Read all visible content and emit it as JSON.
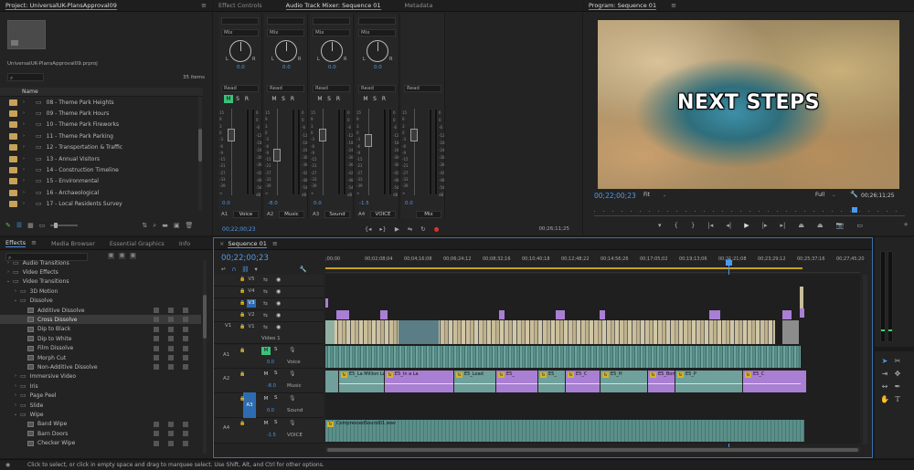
{
  "project": {
    "title": "Project: UniversalUK-PlansApproval09",
    "file": "UniversalUK-PlansApproval09.prproj",
    "count": "35 items",
    "col_name": "Name",
    "bins": [
      "08 - Theme Park Heights",
      "09 - Theme Park Hours",
      "10 - Theme Park Fireworks",
      "11 - Theme Park Parking",
      "12 - Transportation & Traffic",
      "13 - Annual Visitors",
      "14 - Construction Timeline",
      "15 - Environmental",
      "16 - Archaeological",
      "17 - Local Residents Survey"
    ]
  },
  "mixer": {
    "tabs": [
      "Effect Controls",
      "Audio Track Mixer: Sequence 01",
      "Metadata"
    ],
    "channels": [
      {
        "effect": "Mix",
        "pan": "0.0",
        "auto": "Read",
        "vol": "0.0",
        "id": "A1",
        "name": "Voice"
      },
      {
        "effect": "Mix",
        "pan": "0.0",
        "auto": "Read",
        "vol": "-8.0",
        "id": "A2",
        "name": "Music"
      },
      {
        "effect": "Mix",
        "pan": "0.0",
        "auto": "Read",
        "vol": "0.0",
        "id": "A3",
        "name": "Sound"
      },
      {
        "effect": "Mix",
        "pan": "0.0",
        "auto": "Read",
        "vol": "-1.5",
        "id": "A4",
        "name": "VOICE"
      },
      {
        "effect": "",
        "pan": "",
        "auto": "Read",
        "vol": "0.0",
        "id": "",
        "name": "Mix"
      }
    ],
    "scale": [
      "6",
      "0",
      "-6",
      "-12",
      "-18",
      "-24",
      "-30",
      "-36",
      "-42",
      "-48",
      "-54",
      "dB"
    ],
    "scale_left": [
      "15",
      "9",
      "3",
      "0",
      "-3",
      "-6",
      "-9",
      "-15",
      "-21",
      "-27",
      "-33",
      "-39",
      "∞"
    ],
    "tc_left": "00;22;00;23",
    "tc_right": "00;26;11;25",
    "lr_l": "L",
    "lr_r": "R",
    "msr": [
      "M",
      "S",
      "R"
    ]
  },
  "program": {
    "title": "Program: Sequence 01",
    "overlay_text": "NEXT STEPS",
    "tc": "00;22;00;23",
    "fit": "Fit",
    "quality": "Full",
    "duration": "00;26;11;25"
  },
  "effects": {
    "tabs": [
      "Effects",
      "Media Browser",
      "Essential Graphics",
      "Info"
    ],
    "items": [
      {
        "label": "Audio Transitions",
        "indent": 0,
        "kind": "folder",
        "open": false
      },
      {
        "label": "Video Effects",
        "indent": 0,
        "kind": "folder",
        "open": false
      },
      {
        "label": "Video Transitions",
        "indent": 0,
        "kind": "folder",
        "open": true
      },
      {
        "label": "3D Motion",
        "indent": 1,
        "kind": "folder",
        "open": false
      },
      {
        "label": "Dissolve",
        "indent": 1,
        "kind": "folder",
        "open": true
      },
      {
        "label": "Additive Dissolve",
        "indent": 2,
        "kind": "fx",
        "open": false
      },
      {
        "label": "Cross Dissolve",
        "indent": 2,
        "kind": "fx",
        "open": false
      },
      {
        "label": "Dip to Black",
        "indent": 2,
        "kind": "fx",
        "open": false
      },
      {
        "label": "Dip to White",
        "indent": 2,
        "kind": "fx",
        "open": false
      },
      {
        "label": "Film Dissolve",
        "indent": 2,
        "kind": "fx",
        "open": false
      },
      {
        "label": "Morph Cut",
        "indent": 2,
        "kind": "fx",
        "open": false
      },
      {
        "label": "Non-Additive Dissolve",
        "indent": 2,
        "kind": "fx",
        "open": false
      },
      {
        "label": "Immersive Video",
        "indent": 1,
        "kind": "folder",
        "open": false
      },
      {
        "label": "Iris",
        "indent": 1,
        "kind": "folder",
        "open": false
      },
      {
        "label": "Page Peel",
        "indent": 1,
        "kind": "folder",
        "open": false
      },
      {
        "label": "Slide",
        "indent": 1,
        "kind": "folder",
        "open": false
      },
      {
        "label": "Wipe",
        "indent": 1,
        "kind": "folder",
        "open": true
      },
      {
        "label": "Band Wipe",
        "indent": 2,
        "kind": "fx",
        "open": false
      },
      {
        "label": "Barn Doors",
        "indent": 2,
        "kind": "fx",
        "open": false
      },
      {
        "label": "Checker Wipe",
        "indent": 2,
        "kind": "fx",
        "open": false
      }
    ]
  },
  "timeline": {
    "title": "Sequence 01",
    "tc": "00;22;00;23",
    "ruler": [
      ";00;00",
      "00;02;08;04",
      "00;04;16;08",
      "00;06;24;12",
      "00;08;32;16",
      "00;10;40;18",
      "00;12;48;22",
      "00;14;56;26",
      "00;17;05;02",
      "00;19;13;06",
      "00;21;21;08",
      "00;23;29;12",
      "00;25;37;16",
      "00;27;45;20"
    ],
    "video_tracks": [
      "V5",
      "V4",
      "V3",
      "V2",
      "V1"
    ],
    "video1_label": "Video 1",
    "audio_tracks": [
      {
        "id": "A1",
        "vol": "0.0",
        "name": "Voice"
      },
      {
        "id": "A2",
        "vol": "-8.0",
        "name": "Music"
      },
      {
        "id": "A3",
        "vol": "0.0",
        "name": "Sound"
      },
      {
        "id": "A4",
        "vol": "-1.5",
        "name": "VOICE"
      }
    ],
    "music_clips": [
      "E5_La Million Lo",
      "E5_In a La",
      "E5_Load",
      "E5_",
      "E5_",
      "E5_C",
      "E5_H",
      "E5_Born to Be",
      "E5_P",
      "E5_C"
    ],
    "sound_clip": "CompressedSound01.wav",
    "ms": [
      "M",
      "S"
    ]
  },
  "status": {
    "text": "Click to select, or click in empty space and drag to marquee select. Use Shift, Alt, and Ctrl for other options."
  },
  "colors": {
    "accent": "#4a9bf0",
    "audio_clip": "#5c8f8a",
    "video_clip": "#c9bd9a",
    "purple_clip": "#a97fd4",
    "folder": "#c9a25a"
  }
}
